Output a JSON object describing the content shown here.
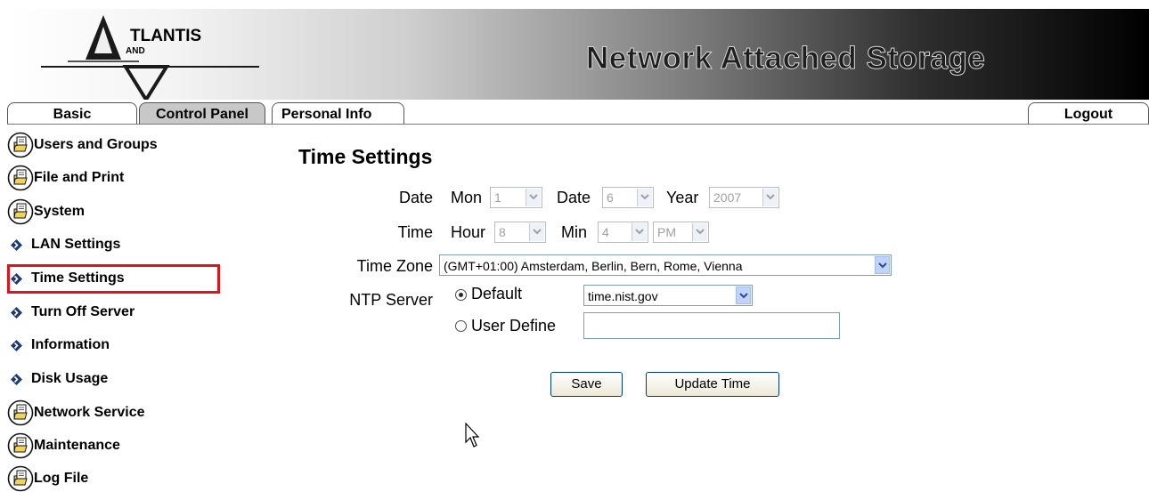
{
  "header": {
    "logo_text": "TLANTIS",
    "logo_sub": "AND",
    "product_title": "Network Attached Storage"
  },
  "tabs": {
    "basic": "Basic",
    "control_panel": "Control Panel",
    "personal_info": "Personal Info",
    "logout": "Logout",
    "active": "Control Panel"
  },
  "sidebar": {
    "selected": "Time Settings",
    "items": [
      {
        "label": "Users and Groups",
        "icon": "folder-icon"
      },
      {
        "label": "File and Print",
        "icon": "folder-icon"
      },
      {
        "label": "System",
        "icon": "folder-icon"
      },
      {
        "label": "LAN Settings",
        "icon": "arrow-icon"
      },
      {
        "label": "Time Settings",
        "icon": "arrow-icon"
      },
      {
        "label": "Turn Off Server",
        "icon": "arrow-icon"
      },
      {
        "label": "Information",
        "icon": "arrow-icon"
      },
      {
        "label": "Disk Usage",
        "icon": "arrow-icon"
      },
      {
        "label": "Network Service",
        "icon": "folder-icon"
      },
      {
        "label": "Maintenance",
        "icon": "folder-icon"
      },
      {
        "label": "Log File",
        "icon": "folder-icon"
      }
    ]
  },
  "form": {
    "title": "Time Settings",
    "date_label": "Date",
    "mon_label": "Mon",
    "mon_value": "1",
    "day_label": "Date",
    "day_value": "6",
    "year_label": "Year",
    "year_value": "2007",
    "time_label": "Time",
    "hour_label": "Hour",
    "hour_value": "8",
    "min_label": "Min",
    "min_value": "4",
    "ampm_value": "PM",
    "timezone_label": "Time Zone",
    "timezone_value": "(GMT+01:00) Amsterdam, Berlin, Bern, Rome, Vienna",
    "ntp_label": "NTP Server",
    "ntp_default_label": "Default",
    "ntp_default_value": "time.nist.gov",
    "ntp_user_label": "User Define",
    "ntp_user_value": "",
    "ntp_selected": "Default",
    "save_label": "Save",
    "update_label": "Update Time"
  },
  "colors": {
    "highlight_border": "#e0131a",
    "active_tab": "#c8c8c8",
    "arrow_icon": "#1d3a6e"
  }
}
